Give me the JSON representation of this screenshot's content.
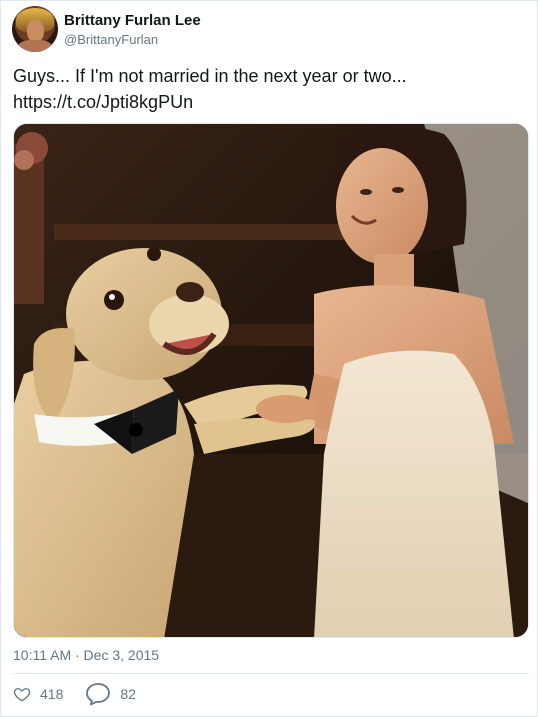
{
  "user": {
    "display_name": "Brittany Furlan Lee",
    "handle": "@BrittanyFurlan"
  },
  "tweet": {
    "text": "Guys... If I'm not married in the next year or two...",
    "link": "https://t.co/Jpti8kgPUn",
    "timestamp": "10:11 AM · Dec 3, 2015"
  },
  "stats": {
    "likes": "418",
    "replies": "82"
  },
  "icons": {
    "like": "heart-icon",
    "reply": "reply-bubble-icon"
  },
  "colors": {
    "text": "#14171a",
    "secondary": "#657786",
    "border": "#e1e8ed"
  }
}
